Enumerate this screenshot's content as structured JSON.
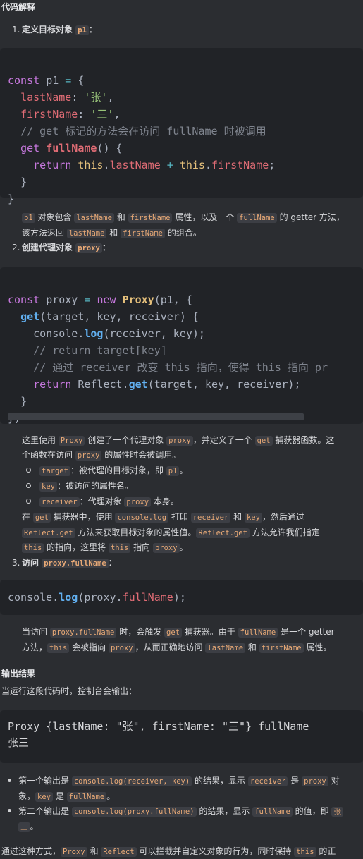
{
  "section_code_explain": "代码解释",
  "step1": {
    "num": "1.",
    "title": "定义目标对象",
    "code": "p1"
  },
  "code1": [
    "const p1 = {",
    "  lastName: '张',",
    "  firstName: '三',",
    "  // get 标记的方法会在访问 fullName 时被调用",
    "  get fullName() {",
    "    return this.lastName + this.firstName;",
    "  }",
    "}"
  ],
  "desc1": {
    "l1_a": "对象包含",
    "l1_b": "和",
    "l1_c": "属性，以及一个",
    "l1_d": "的 getter 方法，",
    "l2_a": "该方法返回",
    "l2_b": "和",
    "l2_c": "的组合。",
    "p1": "p1",
    "lastName": "lastName",
    "firstName": "firstName",
    "fullName": "fullName"
  },
  "step2": {
    "num": "2.",
    "title": "创建代理对象",
    "code": "proxy"
  },
  "code2": [
    "const proxy = new Proxy(p1, {",
    "  get(target, key, receiver) {",
    "    console.log(receiver, key);",
    "    // return target[key]",
    "    // 通过 receiver 改变 this 指向，使得 this 指向 pr",
    "    return Reflect.get(target, key, receiver);",
    "  }",
    "})"
  ],
  "desc2": {
    "a1": "这里使用",
    "a2": "创建了一个代理对象",
    "a3": "，并定义了一个",
    "a4": "捕获器函数。这",
    "b1": "个函数在访问",
    "b2": "的属性时会被调用。",
    "Proxy": "Proxy",
    "proxy": "proxy",
    "get": "get",
    "target": "target",
    "target_desc": "：被代理的目标对象，即",
    "p1": "p1",
    "period": "。",
    "key": "key",
    "key_desc": "：被访问的属性名。",
    "receiver": "receiver",
    "receiver_desc": "：代理对象",
    "receiver_desc2": "本身。",
    "c1": "在",
    "c2": "捕获器中，使用",
    "console_log": "console.log",
    "c3": "打印",
    "c4": "和",
    "c5": "，然后通过",
    "reflect_get": "Reflect.get",
    "d1": "方法来获取目标对象的属性值。",
    "d2": "方法允许我们指定",
    "this": "this",
    "e1": "的指向，这里将",
    "e2": "指向",
    "e3": "。"
  },
  "step3": {
    "num": "3.",
    "title": "访问",
    "code": "proxy.fullName",
    "colon": "："
  },
  "code3": "console.log(proxy.fullName);",
  "desc3": {
    "a1": "当访问",
    "proxy_fullName": "proxy.fullName",
    "a2": "时，会触发",
    "get": "get",
    "a3": "捕获器。由于",
    "fullName": "fullName",
    "a4": "是一个 getter",
    "b1": "方法，",
    "this": "this",
    "b2": "会被指向",
    "proxy": "proxy",
    "b3": "，从而正确地访问",
    "lastName": "lastName",
    "b4": "和",
    "firstName": "firstName",
    "b5": "属性。"
  },
  "section_output": "输出结果",
  "output_intro": "当运行这段代码时，控制台会输出：",
  "output_lines": [
    "Proxy {lastName: \"张\", firstName: \"三\"} fullName",
    "张三"
  ],
  "bullets": {
    "b1_a": "第一个输出是",
    "b1_code": "console.log(receiver, key)",
    "b1_b": "的结果，显示",
    "receiver": "receiver",
    "b1_c": "是",
    "proxy": "proxy",
    "b1_d": "对",
    "b1_e": "象，",
    "key": "key",
    "b1_f": "是",
    "fullName": "fullName",
    "b1_g": "。",
    "b2_a": "第二个输出是",
    "b2_code": "console.log(proxy.fullName)",
    "b2_b": "的结果，显示",
    "b2_c": "的值，即",
    "zhang": "张",
    "san": "三",
    "b2_d": "。"
  },
  "footer": {
    "a": "通过这种方式，",
    "Proxy": "Proxy",
    "b": "和",
    "Reflect": "Reflect",
    "c": "可以拦截并自定义对象的行为，同时保持",
    "this": "this",
    "d": "的正"
  }
}
